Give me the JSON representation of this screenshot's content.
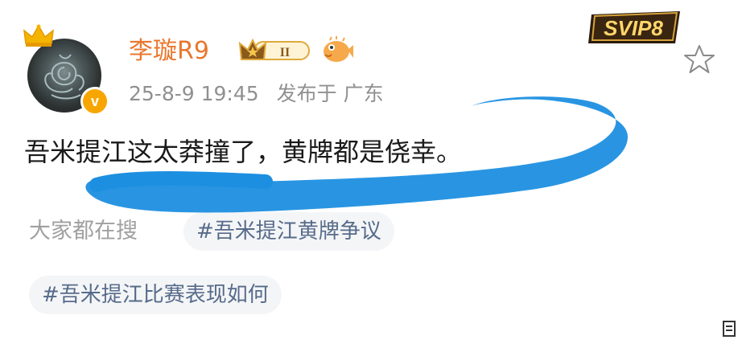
{
  "user": {
    "name": "李璇R9",
    "vip_level": "II",
    "verified_mark": "v"
  },
  "meta": {
    "timestamp": "25-8-9 19:45",
    "location": "发布于 广东"
  },
  "svip": {
    "label": "SVIP8"
  },
  "post": {
    "text": "吾米提江这太莽撞了，黄牌都是侥幸。"
  },
  "search": {
    "label": "大家都在搜",
    "tags": [
      "#吾米提江黄牌争议",
      "#吾米提江比赛表现如何"
    ]
  },
  "icons": {
    "crown": "crown-icon",
    "star": "star-icon",
    "fish": "pufferfish-icon"
  },
  "colors": {
    "username": "#e8772e",
    "tag_text": "#566b8a",
    "scribble": "#1d8fe0",
    "verify": "#f7a600"
  }
}
